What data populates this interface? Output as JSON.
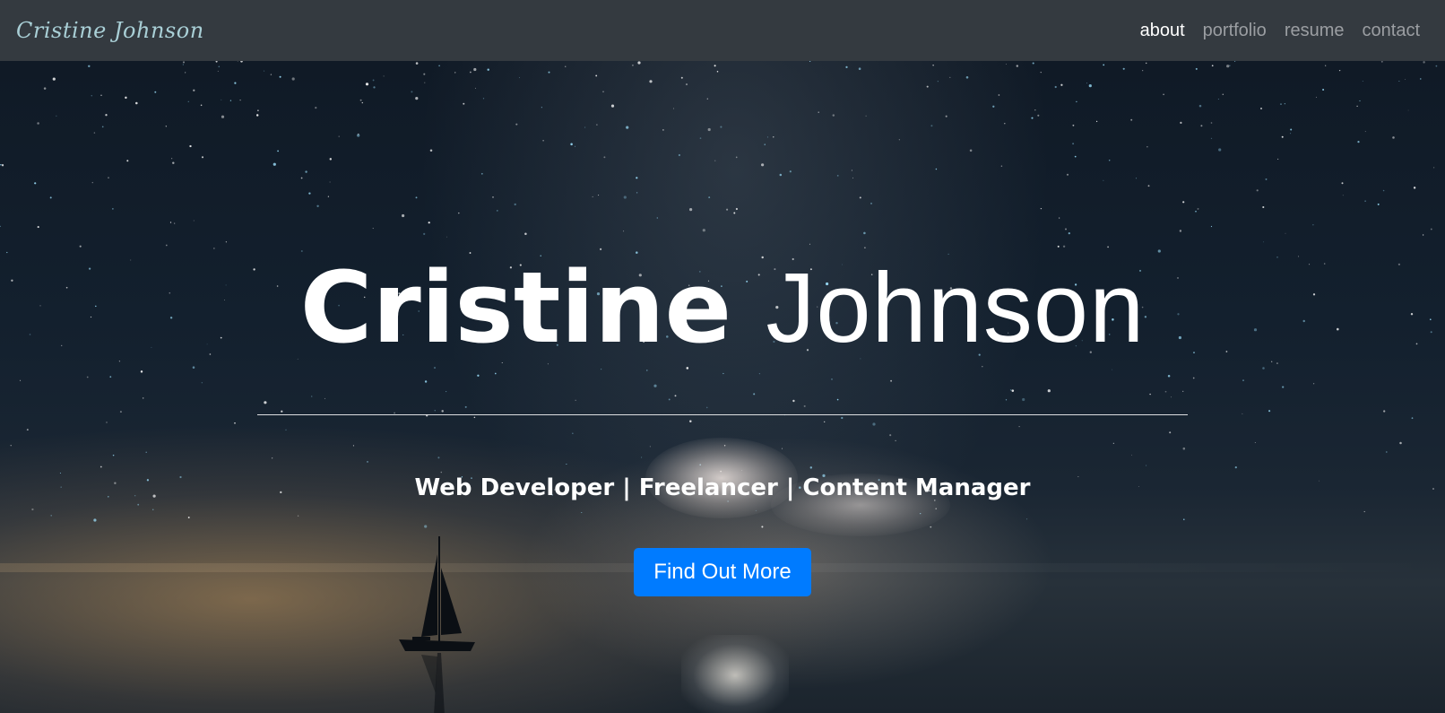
{
  "navbar": {
    "brand": "Cristine Johnson",
    "links": [
      {
        "label": "about",
        "active": true
      },
      {
        "label": "portfolio",
        "active": false
      },
      {
        "label": "resume",
        "active": false
      },
      {
        "label": "contact",
        "active": false
      }
    ]
  },
  "hero": {
    "first_name": "Cristine",
    "last_name": "Johnson",
    "tagline": "Web Developer | Freelancer | Content Manager",
    "cta_label": "Find Out More"
  },
  "colors": {
    "navbar_bg": "#343a40",
    "brand_color": "#a9cfd6",
    "nav_active": "#ffffff",
    "nav_inactive": "#9b9ea2",
    "cta_bg": "#007bff"
  },
  "icons": {
    "boat": "sailboat-silhouette"
  }
}
